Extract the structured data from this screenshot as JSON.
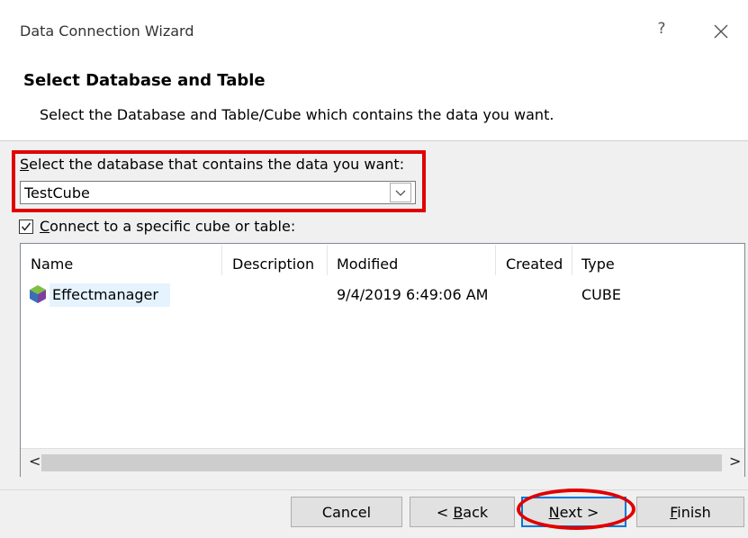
{
  "window": {
    "title": "Data Connection Wizard",
    "help_label": "?"
  },
  "header": {
    "title": "Select Database and Table",
    "subtitle": "Select the Database and Table/Cube which contains the data you want."
  },
  "database": {
    "label_accesskey": "S",
    "label_rest": "elect the database that contains the data you want:",
    "selected": "TestCube"
  },
  "connect_specific": {
    "checked": true,
    "label_accesskey": "C",
    "label_rest": "onnect to a specific cube or table:"
  },
  "table": {
    "columns": [
      "Name",
      "Description",
      "Modified",
      "Created",
      "Type"
    ],
    "rows": [
      {
        "name": "Effectmanager",
        "description": "",
        "modified": "9/4/2019 6:49:06 AM",
        "created": "",
        "type": "CUBE",
        "icon": "cube-icon"
      }
    ]
  },
  "scrollbar": {
    "left_arrow": "<",
    "right_arrow": ">"
  },
  "buttons": {
    "cancel": "Cancel",
    "back_prefix": "< ",
    "back_accesskey": "B",
    "back_rest": "ack",
    "next_accesskey": "N",
    "next_rest": "ext >",
    "finish_accesskey": "F",
    "finish_rest": "inish"
  },
  "colors": {
    "highlight": "#e00000",
    "default_button_border": "#0078d7",
    "selection": "#e5f3ff"
  }
}
